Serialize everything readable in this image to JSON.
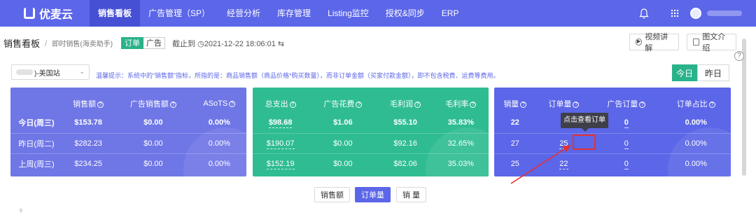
{
  "app": {
    "name": "优麦云"
  },
  "nav": {
    "items": [
      {
        "label": "销售看板",
        "active": true
      },
      {
        "label": "广告管理（SP）",
        "active": false
      },
      {
        "label": "经营分析",
        "active": false
      },
      {
        "label": "库存管理",
        "active": false
      },
      {
        "label": "Listing监控",
        "active": false
      },
      {
        "label": "授权&同步",
        "active": false
      },
      {
        "label": "ERP",
        "active": false
      }
    ],
    "icons": [
      "bell-icon",
      "apps-grid-icon",
      "user-avatar"
    ]
  },
  "header": {
    "breadcrumb_main": "销售看板",
    "breadcrumb_sep": "/",
    "breadcrumb_sub": "即时销售(海卖助手)",
    "tag_active": "订单",
    "tag_inactive": "广告",
    "stamp_prefix": "截止到",
    "stamp_time": "2021-12-22 18:06:01",
    "video_btn": "视频讲解",
    "doc_btn": "图文介绍"
  },
  "filters": {
    "store_suffix": ")-美国站",
    "tip": "温馨提示：系统中的“销售额”指标，所指的是：商品销售额（商品价格*购买数量），而非订单金额（买家付款金额），即不包含税费、运费等费用。",
    "today": "今日",
    "yesterday": "昨日"
  },
  "cards": {
    "sales": {
      "headers": [
        "销售额",
        "广告销售额",
        "ASoTS"
      ],
      "rows": [
        {
          "label": "今日(周三)",
          "values": [
            "$153.78",
            "$0.00",
            "0.00%"
          ]
        },
        {
          "label": "昨日(周二)",
          "values": [
            "$282.23",
            "$0.00",
            "0.00%"
          ]
        },
        {
          "label": "上周(周三)",
          "values": [
            "$234.25",
            "$0.00",
            "0.00%"
          ]
        }
      ]
    },
    "cost": {
      "headers": [
        "总支出",
        "广告花费",
        "毛利润",
        "毛利率"
      ],
      "rows": [
        {
          "values": [
            "$98.68",
            "$1.06",
            "$55.10",
            "35.83%"
          ]
        },
        {
          "values": [
            "$190.07",
            "$0.00",
            "$92.16",
            "32.65%"
          ]
        },
        {
          "values": [
            "$152.19",
            "$0.00",
            "$82.06",
            "35.03%"
          ]
        }
      ]
    },
    "orders": {
      "headers": [
        "销量",
        "订单量",
        "广告订量",
        "订单占比"
      ],
      "rows": [
        {
          "values": [
            "22",
            "",
            "0",
            "0.00%"
          ]
        },
        {
          "values": [
            "27",
            "25",
            "0",
            "0.00%"
          ]
        },
        {
          "values": [
            "25",
            "22",
            "0",
            "0.00%"
          ]
        }
      ]
    },
    "tooltip": "点击查看订单"
  },
  "metric_buttons": [
    {
      "label": "销售额",
      "active": false
    },
    {
      "label": "订单量",
      "active": true
    },
    {
      "label": "销 量",
      "active": false
    }
  ],
  "axis_tick": "5",
  "help": "?",
  "theme": {
    "primary": "#5b66e8",
    "green": "#2fbc92",
    "red": "#e5312f"
  }
}
